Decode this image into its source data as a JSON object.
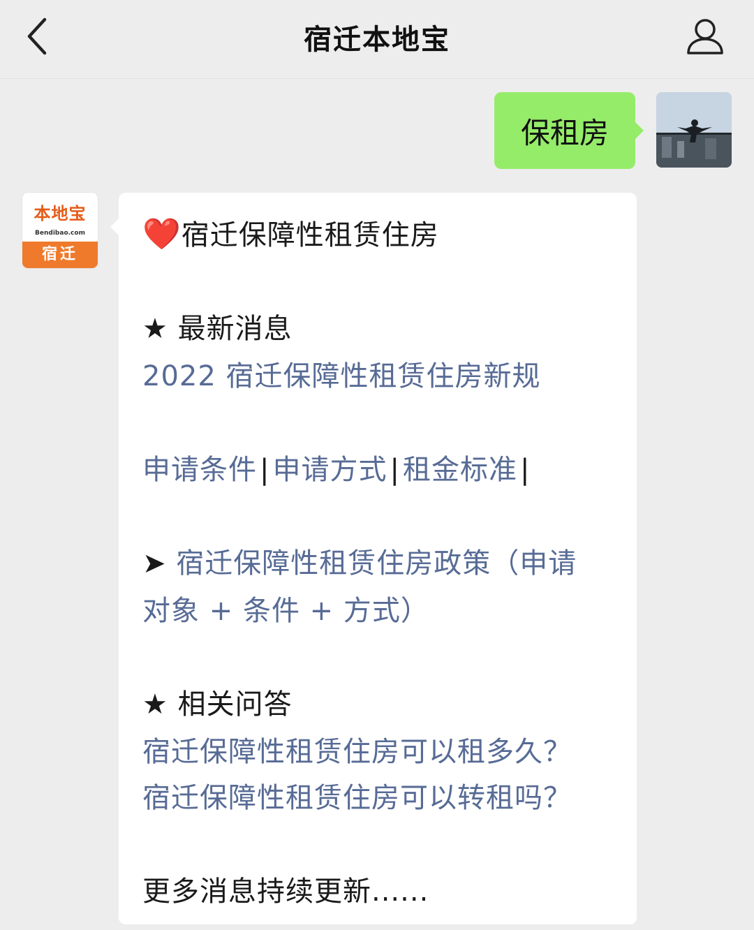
{
  "header": {
    "title": "宿迁本地宝",
    "back_icon": "chevron-left-icon",
    "profile_icon": "person-icon"
  },
  "user_message": {
    "text": "保租房"
  },
  "bot_message": {
    "heart": "❤️",
    "title": "宿迁保障性租赁住房",
    "section1_star": "★",
    "section1_heading": "最新消息",
    "section1_link": "2022 宿迁保障性租赁住房新规",
    "tabs": [
      "申请条件",
      "申请方式",
      "租金标准"
    ],
    "separator": "|",
    "arrow": "➤",
    "policy_link_line1": "宿迁保障性租赁住房政策（申请",
    "policy_link_line2": "对象 + 条件 + 方式）",
    "section2_star": "★",
    "section2_heading": "相关问答",
    "qa_links": [
      "宿迁保障性租赁住房可以租多久？",
      "宿迁保障性租赁住房可以转租吗？"
    ],
    "footer": "更多消息持续更新......"
  },
  "bot_avatar": {
    "logo_cn": "本地宝",
    "logo_en": "Bendibao.com",
    "city": "宿迁"
  },
  "colors": {
    "user_bubble": "#95ec69",
    "link": "#576b95",
    "background": "#ededed",
    "avatar_accent": "#ef7a2c"
  }
}
